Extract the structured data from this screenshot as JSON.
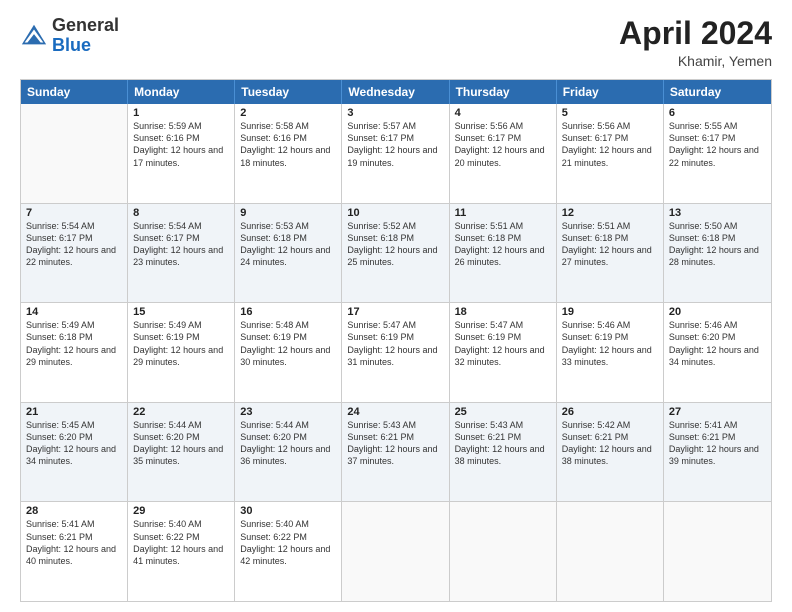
{
  "header": {
    "logo_general": "General",
    "logo_blue": "Blue",
    "month_year": "April 2024",
    "location": "Khamir, Yemen"
  },
  "weekdays": [
    "Sunday",
    "Monday",
    "Tuesday",
    "Wednesday",
    "Thursday",
    "Friday",
    "Saturday"
  ],
  "rows": [
    [
      {
        "day": "",
        "sunrise": "",
        "sunset": "",
        "daylight": ""
      },
      {
        "day": "1",
        "sunrise": "Sunrise: 5:59 AM",
        "sunset": "Sunset: 6:16 PM",
        "daylight": "Daylight: 12 hours and 17 minutes."
      },
      {
        "day": "2",
        "sunrise": "Sunrise: 5:58 AM",
        "sunset": "Sunset: 6:16 PM",
        "daylight": "Daylight: 12 hours and 18 minutes."
      },
      {
        "day": "3",
        "sunrise": "Sunrise: 5:57 AM",
        "sunset": "Sunset: 6:17 PM",
        "daylight": "Daylight: 12 hours and 19 minutes."
      },
      {
        "day": "4",
        "sunrise": "Sunrise: 5:56 AM",
        "sunset": "Sunset: 6:17 PM",
        "daylight": "Daylight: 12 hours and 20 minutes."
      },
      {
        "day": "5",
        "sunrise": "Sunrise: 5:56 AM",
        "sunset": "Sunset: 6:17 PM",
        "daylight": "Daylight: 12 hours and 21 minutes."
      },
      {
        "day": "6",
        "sunrise": "Sunrise: 5:55 AM",
        "sunset": "Sunset: 6:17 PM",
        "daylight": "Daylight: 12 hours and 22 minutes."
      }
    ],
    [
      {
        "day": "7",
        "sunrise": "Sunrise: 5:54 AM",
        "sunset": "Sunset: 6:17 PM",
        "daylight": "Daylight: 12 hours and 22 minutes."
      },
      {
        "day": "8",
        "sunrise": "Sunrise: 5:54 AM",
        "sunset": "Sunset: 6:17 PM",
        "daylight": "Daylight: 12 hours and 23 minutes."
      },
      {
        "day": "9",
        "sunrise": "Sunrise: 5:53 AM",
        "sunset": "Sunset: 6:18 PM",
        "daylight": "Daylight: 12 hours and 24 minutes."
      },
      {
        "day": "10",
        "sunrise": "Sunrise: 5:52 AM",
        "sunset": "Sunset: 6:18 PM",
        "daylight": "Daylight: 12 hours and 25 minutes."
      },
      {
        "day": "11",
        "sunrise": "Sunrise: 5:51 AM",
        "sunset": "Sunset: 6:18 PM",
        "daylight": "Daylight: 12 hours and 26 minutes."
      },
      {
        "day": "12",
        "sunrise": "Sunrise: 5:51 AM",
        "sunset": "Sunset: 6:18 PM",
        "daylight": "Daylight: 12 hours and 27 minutes."
      },
      {
        "day": "13",
        "sunrise": "Sunrise: 5:50 AM",
        "sunset": "Sunset: 6:18 PM",
        "daylight": "Daylight: 12 hours and 28 minutes."
      }
    ],
    [
      {
        "day": "14",
        "sunrise": "Sunrise: 5:49 AM",
        "sunset": "Sunset: 6:18 PM",
        "daylight": "Daylight: 12 hours and 29 minutes."
      },
      {
        "day": "15",
        "sunrise": "Sunrise: 5:49 AM",
        "sunset": "Sunset: 6:19 PM",
        "daylight": "Daylight: 12 hours and 29 minutes."
      },
      {
        "day": "16",
        "sunrise": "Sunrise: 5:48 AM",
        "sunset": "Sunset: 6:19 PM",
        "daylight": "Daylight: 12 hours and 30 minutes."
      },
      {
        "day": "17",
        "sunrise": "Sunrise: 5:47 AM",
        "sunset": "Sunset: 6:19 PM",
        "daylight": "Daylight: 12 hours and 31 minutes."
      },
      {
        "day": "18",
        "sunrise": "Sunrise: 5:47 AM",
        "sunset": "Sunset: 6:19 PM",
        "daylight": "Daylight: 12 hours and 32 minutes."
      },
      {
        "day": "19",
        "sunrise": "Sunrise: 5:46 AM",
        "sunset": "Sunset: 6:19 PM",
        "daylight": "Daylight: 12 hours and 33 minutes."
      },
      {
        "day": "20",
        "sunrise": "Sunrise: 5:46 AM",
        "sunset": "Sunset: 6:20 PM",
        "daylight": "Daylight: 12 hours and 34 minutes."
      }
    ],
    [
      {
        "day": "21",
        "sunrise": "Sunrise: 5:45 AM",
        "sunset": "Sunset: 6:20 PM",
        "daylight": "Daylight: 12 hours and 34 minutes."
      },
      {
        "day": "22",
        "sunrise": "Sunrise: 5:44 AM",
        "sunset": "Sunset: 6:20 PM",
        "daylight": "Daylight: 12 hours and 35 minutes."
      },
      {
        "day": "23",
        "sunrise": "Sunrise: 5:44 AM",
        "sunset": "Sunset: 6:20 PM",
        "daylight": "Daylight: 12 hours and 36 minutes."
      },
      {
        "day": "24",
        "sunrise": "Sunrise: 5:43 AM",
        "sunset": "Sunset: 6:21 PM",
        "daylight": "Daylight: 12 hours and 37 minutes."
      },
      {
        "day": "25",
        "sunrise": "Sunrise: 5:43 AM",
        "sunset": "Sunset: 6:21 PM",
        "daylight": "Daylight: 12 hours and 38 minutes."
      },
      {
        "day": "26",
        "sunrise": "Sunrise: 5:42 AM",
        "sunset": "Sunset: 6:21 PM",
        "daylight": "Daylight: 12 hours and 38 minutes."
      },
      {
        "day": "27",
        "sunrise": "Sunrise: 5:41 AM",
        "sunset": "Sunset: 6:21 PM",
        "daylight": "Daylight: 12 hours and 39 minutes."
      }
    ],
    [
      {
        "day": "28",
        "sunrise": "Sunrise: 5:41 AM",
        "sunset": "Sunset: 6:21 PM",
        "daylight": "Daylight: 12 hours and 40 minutes."
      },
      {
        "day": "29",
        "sunrise": "Sunrise: 5:40 AM",
        "sunset": "Sunset: 6:22 PM",
        "daylight": "Daylight: 12 hours and 41 minutes."
      },
      {
        "day": "30",
        "sunrise": "Sunrise: 5:40 AM",
        "sunset": "Sunset: 6:22 PM",
        "daylight": "Daylight: 12 hours and 42 minutes."
      },
      {
        "day": "",
        "sunrise": "",
        "sunset": "",
        "daylight": ""
      },
      {
        "day": "",
        "sunrise": "",
        "sunset": "",
        "daylight": ""
      },
      {
        "day": "",
        "sunrise": "",
        "sunset": "",
        "daylight": ""
      },
      {
        "day": "",
        "sunrise": "",
        "sunset": "",
        "daylight": ""
      }
    ]
  ]
}
